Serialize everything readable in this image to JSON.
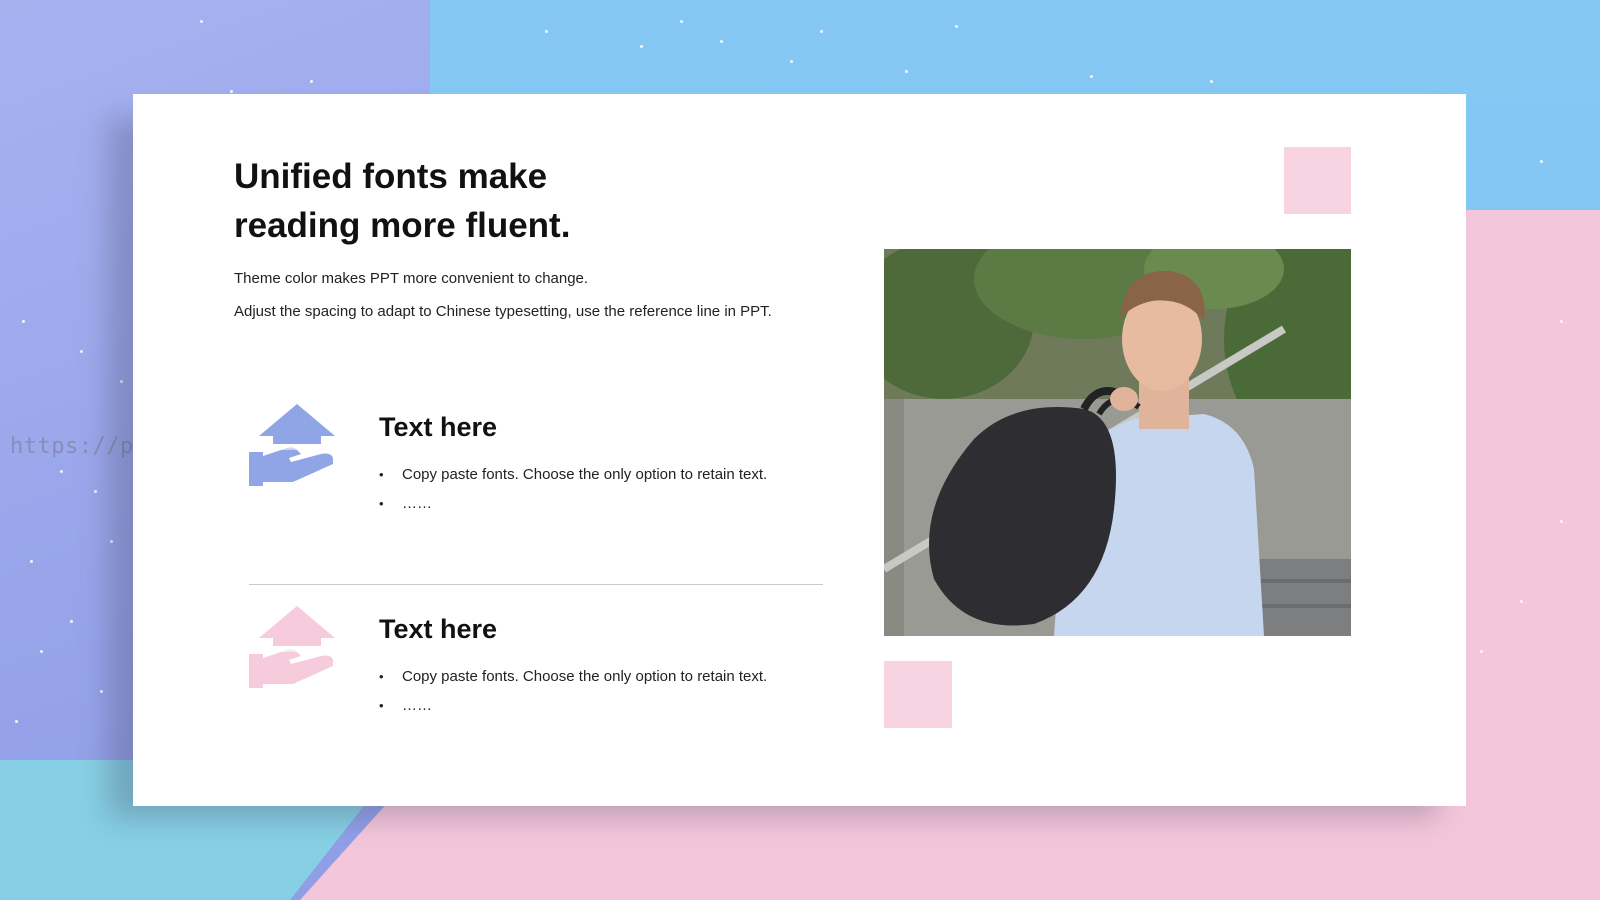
{
  "watermark": "https://ppt.pkll.de",
  "slide": {
    "title_line_1": "Unified fonts make",
    "title_line_2": "reading more fluent.",
    "body_line_1": "Theme color makes PPT more convenient to change.",
    "body_line_2": "Adjust the spacing to adapt to Chinese typesetting, use the reference line in PPT."
  },
  "features": [
    {
      "heading": "Text here",
      "icon": "hand-house-icon",
      "color": "#8fa5e6",
      "bullets": [
        "Copy paste fonts. Choose the only option to retain text.",
        "……"
      ]
    },
    {
      "heading": "Text here",
      "icon": "hand-house-icon",
      "color": "#f6cbdc",
      "bullets": [
        "Copy paste fonts. Choose the only option to retain text.",
        "……"
      ]
    }
  ],
  "colors": {
    "accent_blue": "#8fa5e6",
    "accent_pink": "#f8d3e1",
    "background_sky": "#86c8f4",
    "background_pink": "#f4c6db"
  }
}
